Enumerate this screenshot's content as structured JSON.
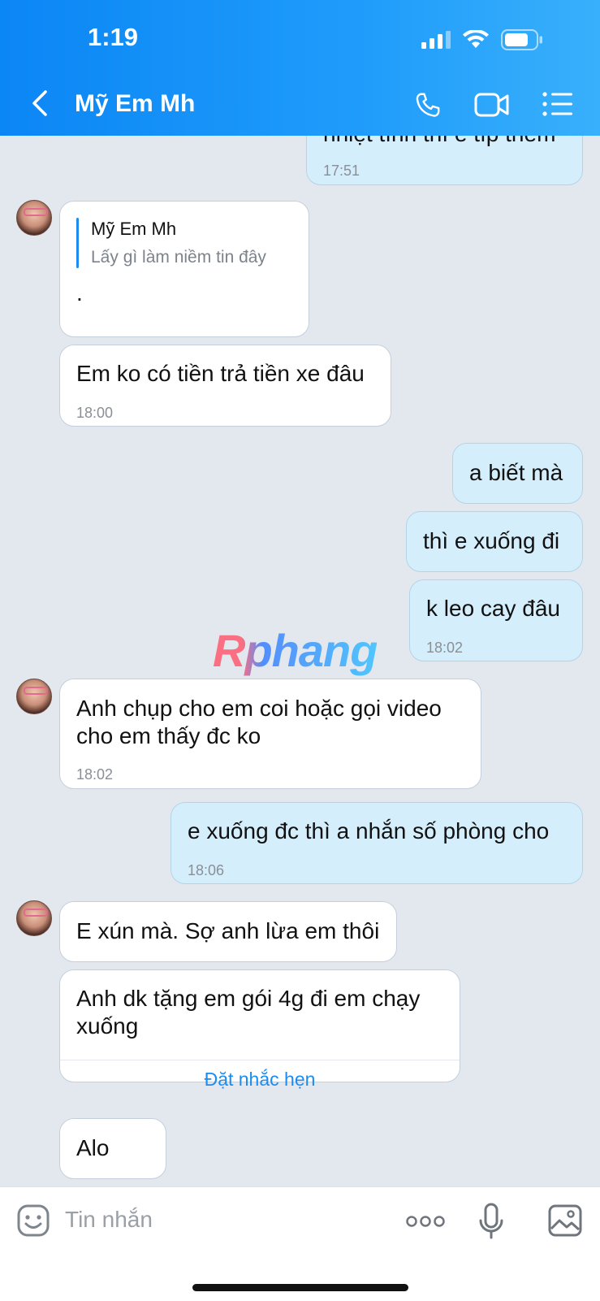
{
  "status": {
    "time": "1:19"
  },
  "header": {
    "contact_name": "Mỹ Em Mh"
  },
  "messages": {
    "m0": {
      "text": "nhiệt tình thì e típ thêm",
      "time": "17:51"
    },
    "m1": {
      "quote_author": "Mỹ Em Mh",
      "quote_text": "Lấy gì làm niềm tin đây",
      "text": "."
    },
    "m2": {
      "text": "Em ko có tiền trả tiền xe đâu",
      "time": "18:00"
    },
    "m3": {
      "text": "a biết mà"
    },
    "m4": {
      "text": "thì e xuống đi"
    },
    "m5": {
      "text": "k leo cay đâu",
      "time": "18:02"
    },
    "m6": {
      "text": "Anh chụp cho em coi hoặc gọi video cho em thấy đc ko",
      "time": "18:02"
    },
    "m7": {
      "text": "e xuống đc thì a nhắn số phòng cho",
      "time": "18:06"
    },
    "m8": {
      "text": "E xún mà. Sợ anh lừa em thôi"
    },
    "m9": {
      "text": "Anh dk tặng em gói 4g đi em chạy xuống",
      "action": "Đặt nhắc hẹn"
    },
    "m10": {
      "text": "Alo"
    }
  },
  "watermark": "Rphang",
  "input": {
    "placeholder": "Tin nhắn"
  },
  "colors": {
    "header": "#1a8cf2",
    "accent": "#1a8cf2",
    "outgoing": "#d5eefc",
    "incoming": "#ffffff",
    "background": "#e3e8ef"
  }
}
